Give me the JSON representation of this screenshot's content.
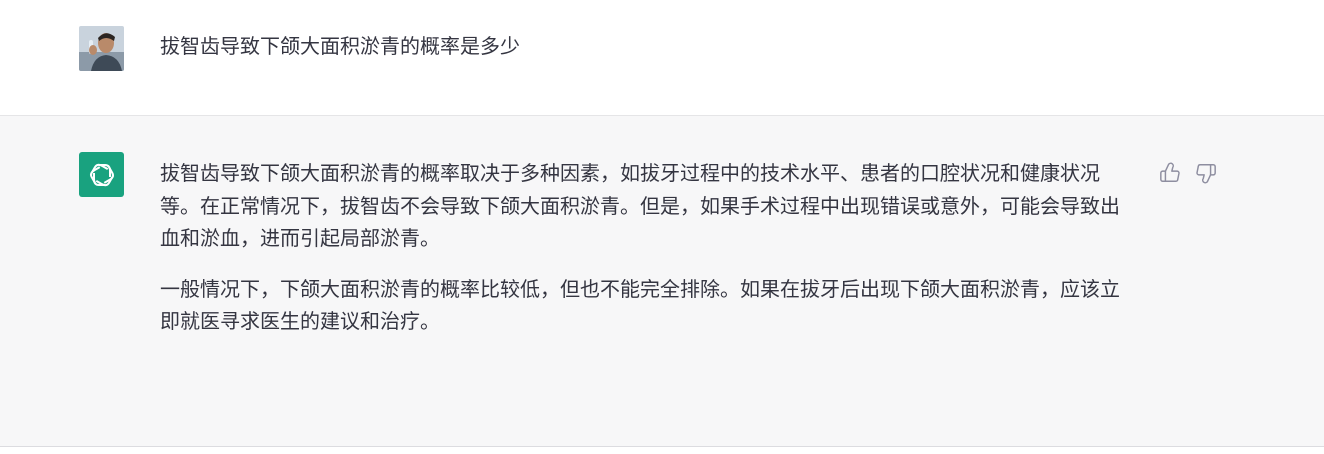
{
  "conversation": {
    "user_message": {
      "avatar": "user-photo-avatar",
      "text": "拔智齿导致下颌大面积淤青的概率是多少"
    },
    "assistant_message": {
      "avatar": "openai-logo-icon",
      "avatar_color": "#19a27f",
      "paragraphs": [
        "拔智齿导致下颌大面积淤青的概率取决于多种因素，如拔牙过程中的技术水平、患者的口腔状况和健康状况等。在正常情况下，拔智齿不会导致下颌大面积淤青。但是，如果手术过程中出现错误或意外，可能会导致出血和淤血，进而引起局部淤青。",
        "一般情况下，下颌大面积淤青的概率比较低，但也不能完全排除。如果在拔牙后出现下颌大面积淤青，应该立即就医寻求医生的建议和治疗。"
      ],
      "feedback": {
        "thumbs_up": "thumbs-up-icon",
        "thumbs_down": "thumbs-down-icon"
      }
    }
  }
}
